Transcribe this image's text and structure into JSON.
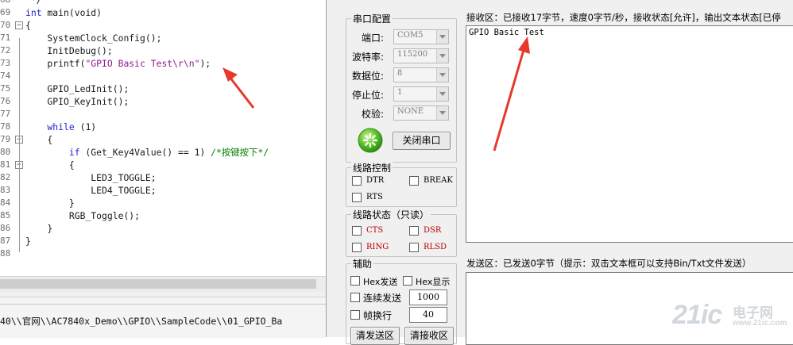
{
  "editor": {
    "lines": [
      {
        "n": "68",
        "text": " */"
      },
      {
        "n": "69",
        "kw": "int",
        "text": " main(void)"
      },
      {
        "n": "70",
        "text": "{"
      },
      {
        "n": "71",
        "text": "    SystemClock_Config();"
      },
      {
        "n": "72",
        "text": "    InitDebug();"
      },
      {
        "n": "73",
        "pre": "    printf(",
        "str": "\"GPIO Basic Test\\r\\n\"",
        "post": ");"
      },
      {
        "n": "74",
        "text": ""
      },
      {
        "n": "75",
        "text": "    GPIO_LedInit();"
      },
      {
        "n": "76",
        "text": "    GPIO_KeyInit();"
      },
      {
        "n": "77",
        "text": ""
      },
      {
        "n": "78",
        "kw": "    while",
        "text": " (1)"
      },
      {
        "n": "79",
        "text": "    {"
      },
      {
        "n": "80",
        "kw": "        if",
        "text": " (Get_Key4Value() == 1) ",
        "cmt": "/*按键按下*/"
      },
      {
        "n": "81",
        "text": "        {"
      },
      {
        "n": "82",
        "text": "            LED3_TOGGLE;"
      },
      {
        "n": "83",
        "text": "            LED4_TOGGLE;"
      },
      {
        "n": "84",
        "text": "        }"
      },
      {
        "n": "85",
        "text": "        RGB_Toggle();"
      },
      {
        "n": "86",
        "text": "    }"
      },
      {
        "n": "87",
        "text": "}"
      },
      {
        "n": "88",
        "text": ""
      }
    ],
    "path": "40\\\\官网\\\\AC7840x_Demo\\\\GPIO\\\\SampleCode\\\\01_GPIO_Ba"
  },
  "serial": {
    "port_group": {
      "title": "串口配置",
      "port_label": "端口:",
      "port_value": "COM5",
      "baud_label": "波特率:",
      "baud_value": "115200",
      "data_label": "数据位:",
      "data_value": "8",
      "stop_label": "停止位:",
      "stop_value": "1",
      "parity_label": "校验:",
      "parity_value": "NONE",
      "close_button": "关闭串口"
    },
    "line_control": {
      "title": "线路控制",
      "dtr": "DTR",
      "break": "BREAK",
      "rts": "RTS"
    },
    "line_status": {
      "title": "线路状态（只读）",
      "cts": "CTS",
      "dsr": "DSR",
      "ring": "RING",
      "rlsd": "RLSD"
    },
    "assist": {
      "title": "辅助",
      "hex_send": "Hex发送",
      "hex_display": "Hex显示",
      "continuous": "连续发送",
      "continuous_value": "1000",
      "frame": "帧换行",
      "frame_value": "40",
      "clear_send": "清发送区",
      "clear_recv": "清接收区"
    },
    "receive": {
      "title": "接收区：已接收17字节，速度0字节/秒，接收状态[允许]，输出文本状态[已停",
      "content": "GPIO Basic Test"
    },
    "send": {
      "title": "发送区：已发送0字节（提示：双击文本框可以支持Bin/Txt文件发送）"
    }
  },
  "watermark": {
    "text_main": "21ic",
    "text_cn": "电子网",
    "text_domain": "www.21ic.com"
  },
  "colors": {
    "keyword": "#1f1fd0",
    "string": "#8b1a8b",
    "comment": "#008000",
    "arrow": "#e8382c",
    "status_red": "#c00000"
  }
}
